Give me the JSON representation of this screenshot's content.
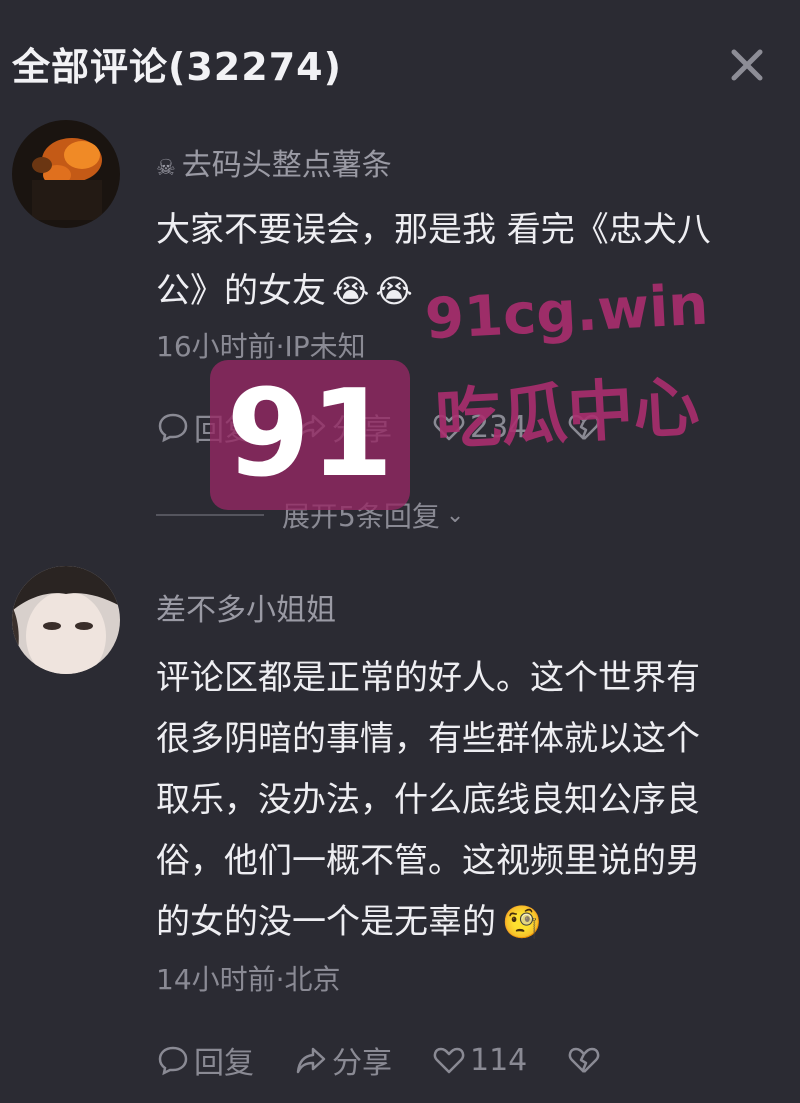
{
  "header": {
    "title": "全部评论(32274)",
    "close_icon": "close-icon"
  },
  "comments": [
    {
      "username": "去码头整点薯条",
      "username_prefix_icon": "skull-icon",
      "text_line1": "大家不要误会，那是我 看完《忠犬八",
      "text_line2": "公》的女友",
      "emojis": [
        "😭",
        "😭"
      ],
      "meta": "16小时前·IP未知",
      "actions": {
        "reply_label": "回复",
        "share_label": "分享",
        "like_count": "234"
      },
      "expand_label": "展开5条回复"
    },
    {
      "username": "差不多小姐姐",
      "text_lines": [
        "评论区都是正常的好人。这个世界有",
        "很多阴暗的事情，有些群体就以这个",
        "取乐，没办法，什么底线良知公序良",
        "俗，他们一概不管。这视频里说的男",
        "的女的没一个是无辜的"
      ],
      "emoji": "🧐",
      "meta": "14小时前·北京",
      "actions": {
        "reply_label": "回复",
        "share_label": "分享",
        "like_count": "114"
      }
    }
  ],
  "watermark": {
    "logo_text": "91",
    "url": "91cg.win",
    "name": "吃瓜中心"
  }
}
